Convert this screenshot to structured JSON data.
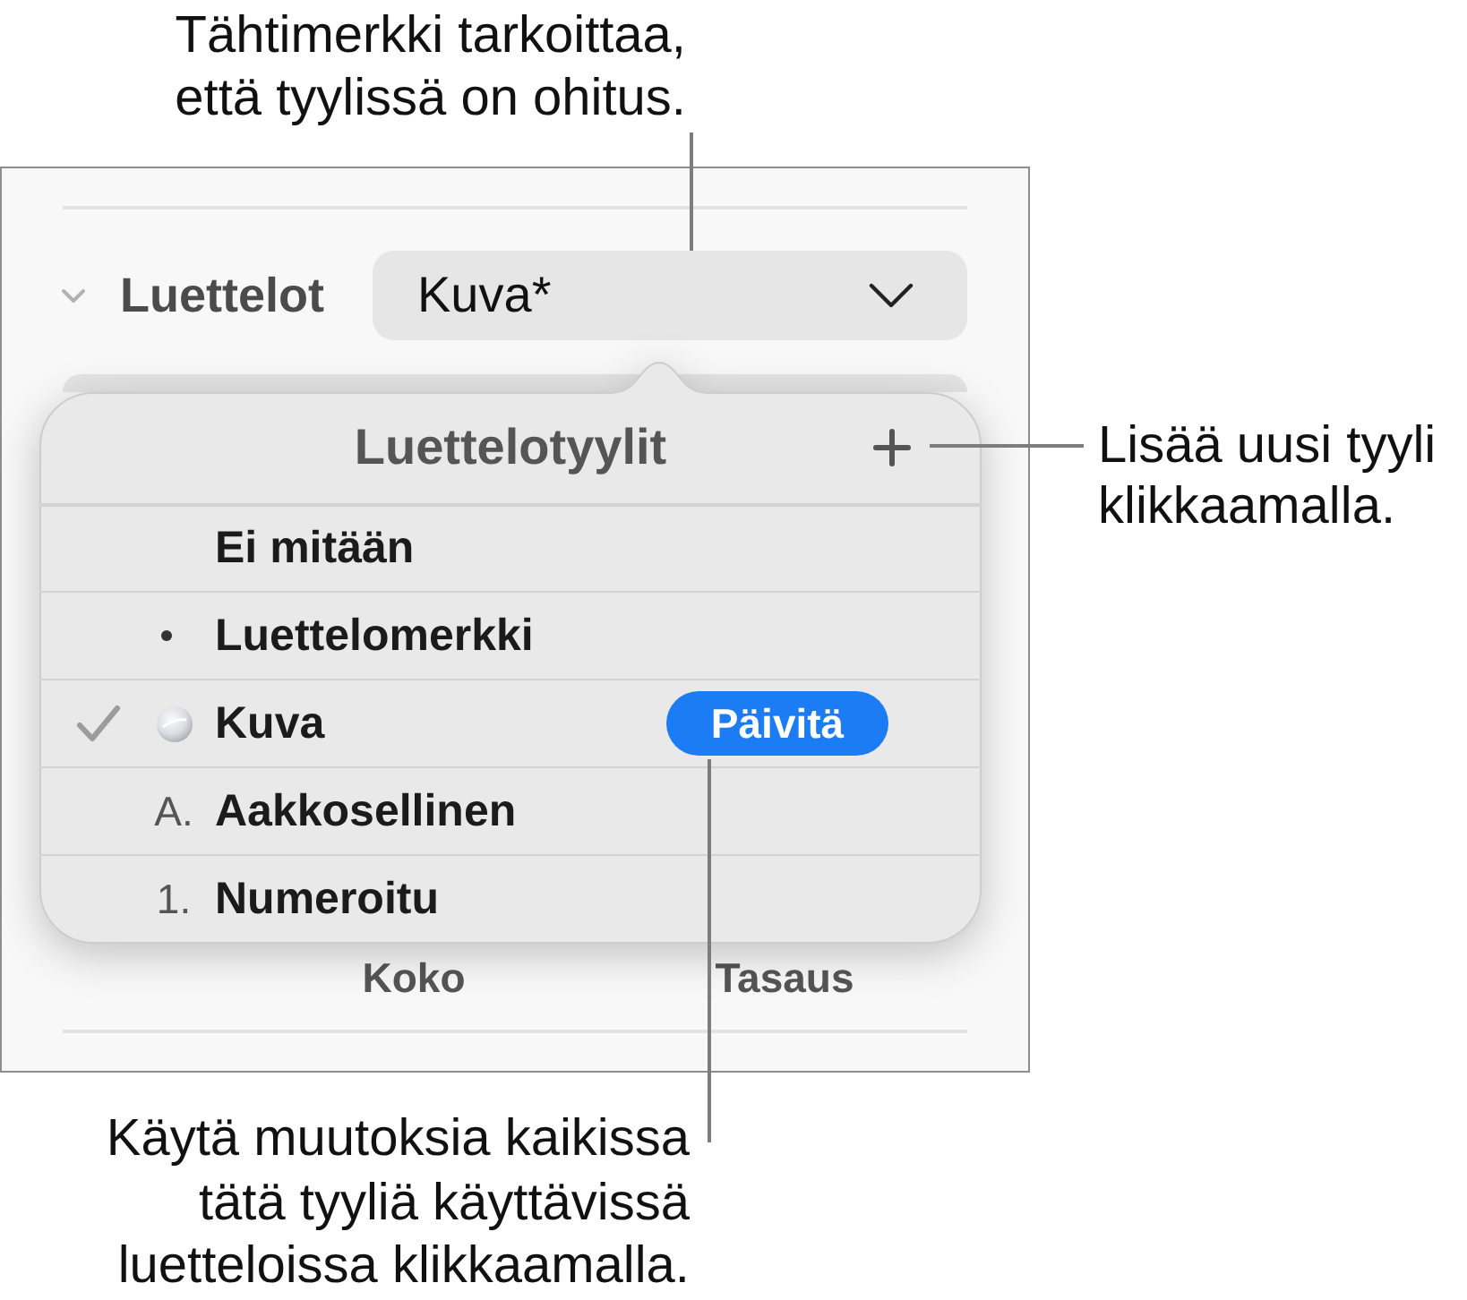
{
  "annotations": [
    {
      "text": "Tähtimerkki tarkoittaa,\nettä tyylissä on ohitus."
    },
    {
      "text": "Lisää uusi tyyli\nklikkaamalla."
    },
    {
      "text": "Käytä muutoksia kaikissa\ntätä tyyliä käyttävissä\nluetteloissa klikkaamalla."
    }
  ],
  "inspector": {
    "section": {
      "title": "Luettelot",
      "expanded": true
    },
    "dropdown": {
      "value": "Kuva*"
    },
    "labels": [
      "Koko",
      "Tasaus"
    ]
  },
  "popover": {
    "title": "Luettelotyylit",
    "styles": [
      {
        "name": "Ei mitään",
        "kind": "none",
        "selected": false
      },
      {
        "name": "Luettelomerkki",
        "kind": "bullet",
        "selected": false
      },
      {
        "name": "Kuva",
        "kind": "image",
        "selected": true,
        "action": "Päivitä"
      },
      {
        "name": "Aakkosellinen",
        "kind": "letter",
        "marker": "A.",
        "selected": false
      },
      {
        "name": "Numeroitu",
        "kind": "number",
        "marker": "1.",
        "selected": false
      }
    ]
  }
}
